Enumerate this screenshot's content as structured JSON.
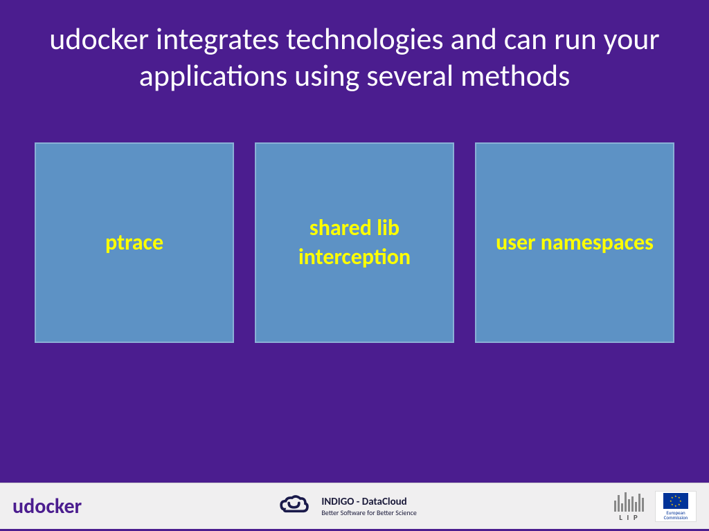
{
  "slide": {
    "title": "udocker integrates technologies and can run your applications using several methods",
    "boxes": [
      {
        "label": "ptrace"
      },
      {
        "label": "shared lib interception"
      },
      {
        "label": "user namespaces"
      }
    ]
  },
  "footer": {
    "brand": "udocker",
    "indigo": {
      "title": "INDIGO - DataCloud",
      "subtitle": "Better Software for Better Science"
    },
    "lip": "L I P",
    "ec": "European Commission"
  }
}
